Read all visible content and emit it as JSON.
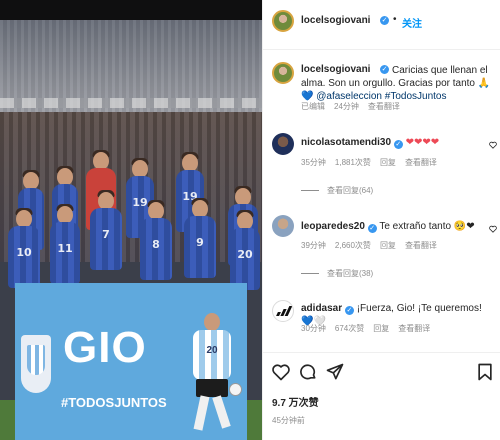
{
  "post": {
    "banner_title": "GIO",
    "banner_hashtag": "#TODOSJUNTOS",
    "player_numbers": [
      "10",
      "11",
      "19",
      "7",
      "8",
      "9",
      "20",
      "19",
      "20"
    ],
    "runner_number": "20"
  },
  "header": {
    "username": "locelsogiovani",
    "separator": "•",
    "follow_label": "关注",
    "more_label": "•••"
  },
  "caption": {
    "username": "locelsogiovani",
    "text": "Caricias que llenan el alma. Son un orgullo. Gracias por tanto 🙏💙 ",
    "mention": "@afaseleccion",
    "hashtag": "#TodosJuntos",
    "status": "已编辑",
    "time": "24分钟",
    "translate": "查看翻译"
  },
  "comments": [
    {
      "username": "nicolasotamendi30",
      "text": "❤❤❤❤",
      "time": "35分钟",
      "likes": "1,881次赞",
      "reply": "回复",
      "translate": "查看翻译",
      "view_replies": "查看回复(64)"
    },
    {
      "username": "leoparedes20",
      "text": "Te extraño tanto 🥺❤",
      "time": "39分钟",
      "likes": "2,660次赞",
      "reply": "回复",
      "translate": "查看翻译",
      "view_replies": "查看回复(38)"
    },
    {
      "username": "adidasar",
      "text": "¡Fuerza, Gio! ¡Te queremos! 💙🤍",
      "time": "30分钟",
      "likes": "674次赞",
      "reply": "回复",
      "translate": "查看翻译"
    }
  ],
  "footer": {
    "likes": "9.7 万次赞",
    "time_ago": "45分钟前"
  },
  "colors": {
    "link": "#00376b",
    "follow": "#0095f6",
    "verified": "#3897f0",
    "heart": "#ed4956"
  }
}
